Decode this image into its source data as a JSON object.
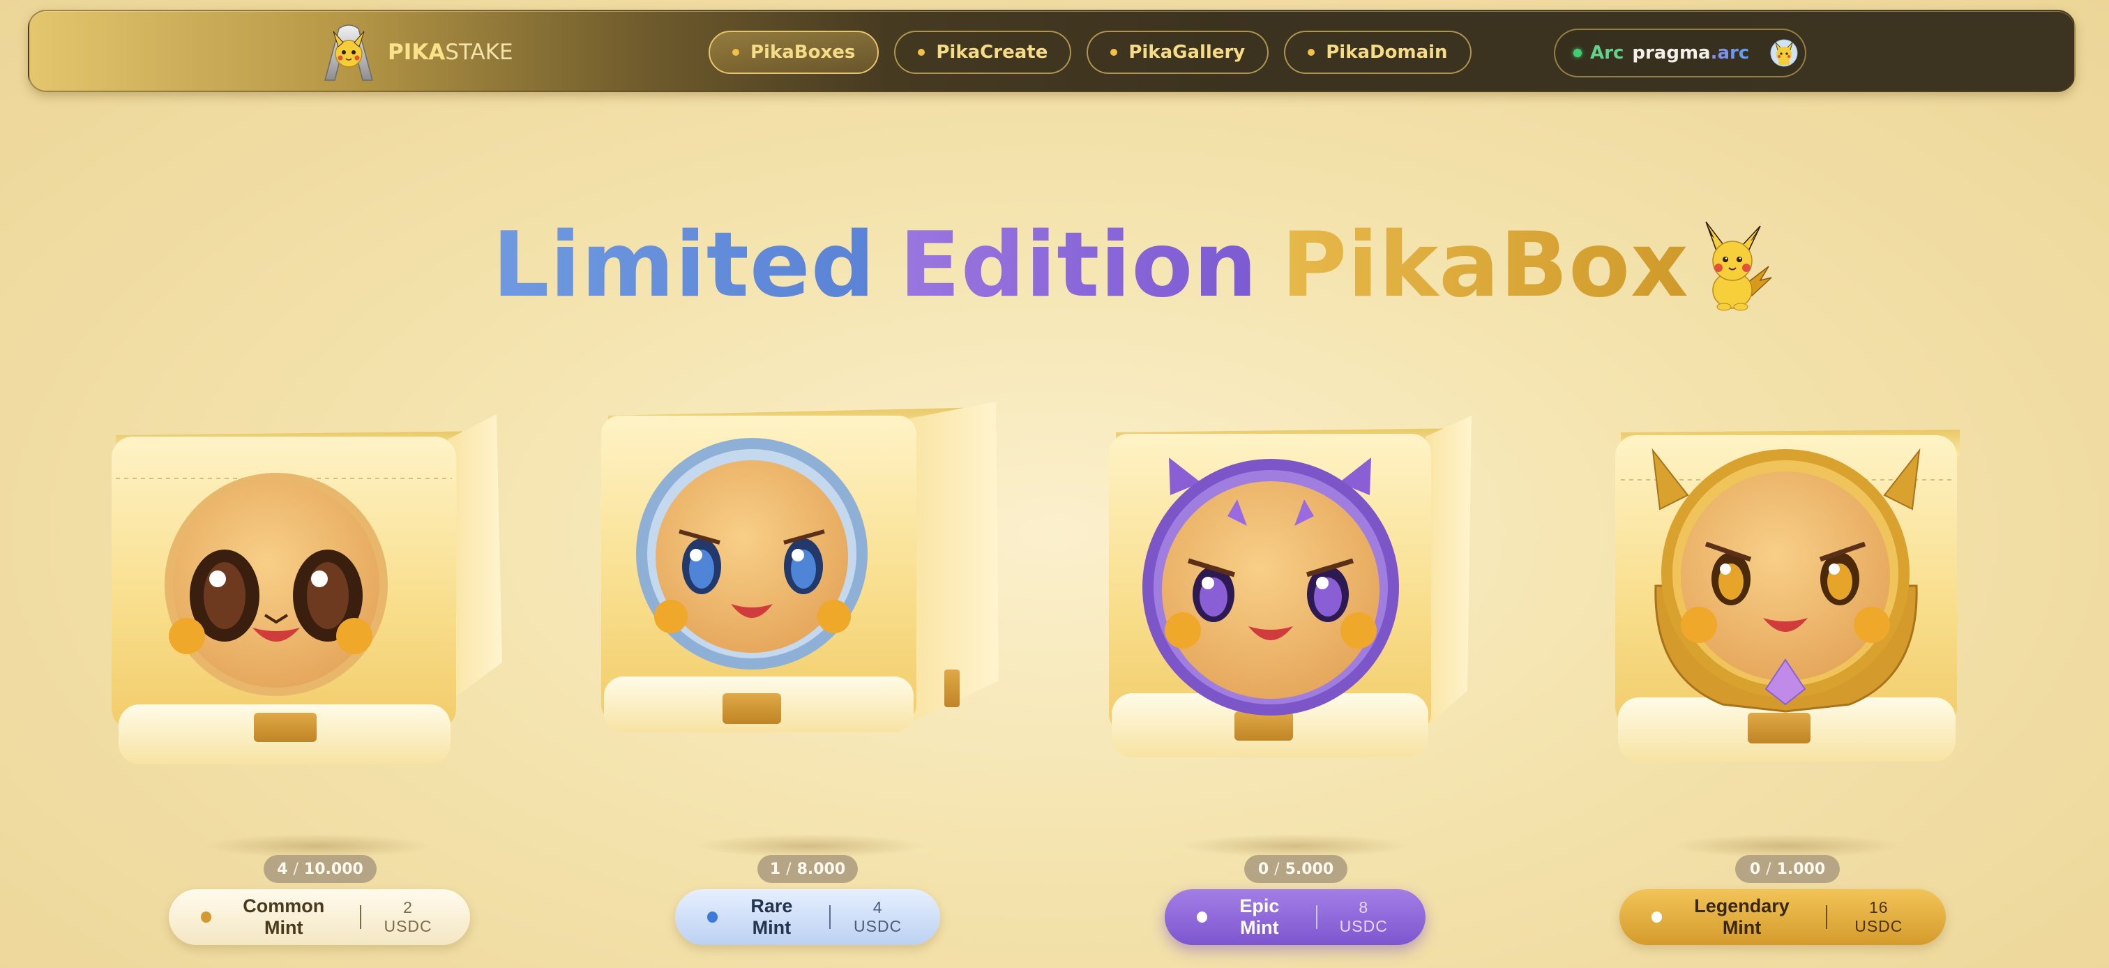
{
  "nav": {
    "brand_bold": "PIKA",
    "brand_light": "STAKE",
    "items": [
      {
        "label": "PikaBoxes",
        "active": true
      },
      {
        "label": "PikaCreate",
        "active": false
      },
      {
        "label": "PikaGallery",
        "active": false
      },
      {
        "label": "PikaDomain",
        "active": false
      }
    ],
    "wallet": {
      "network": "Arc",
      "name": "pragma",
      "tld": ".arc",
      "status_color": "#3fcf72"
    }
  },
  "hero": {
    "title_part1": "Limited",
    "title_part2": "Edition",
    "title_part3": "PikaBox"
  },
  "boxes": [
    {
      "tier": "common",
      "minted": "4",
      "supply": "10.000",
      "mint_label": "Common Mint",
      "price": "2 USDC",
      "accent": "#c79a4a"
    },
    {
      "tier": "rare",
      "minted": "1",
      "supply": "8.000",
      "mint_label": "Rare Mint",
      "price": "4 USDC",
      "accent": "#8fb0d6"
    },
    {
      "tier": "epic",
      "minted": "0",
      "supply": "5.000",
      "mint_label": "Epic Mint",
      "price": "8 USDC",
      "accent": "#8a5fd6"
    },
    {
      "tier": "legendary",
      "minted": "0",
      "supply": "1.000",
      "mint_label": "Legendary Mint",
      "price": "16 USDC",
      "accent": "#d9a22e"
    }
  ]
}
